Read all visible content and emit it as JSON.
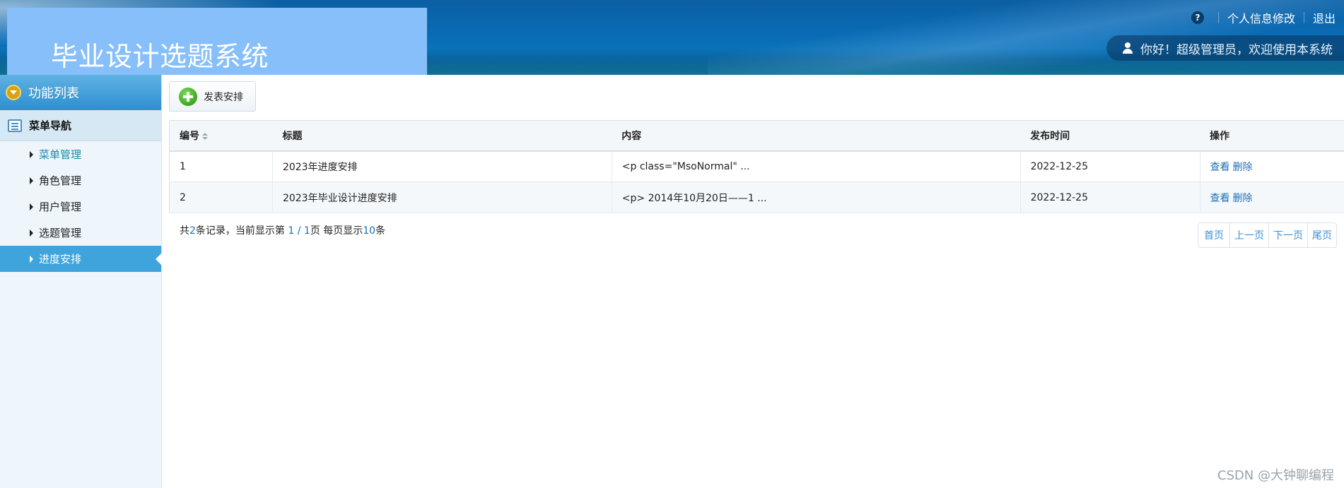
{
  "header": {
    "title": "毕业设计选题系统",
    "help_label": "?",
    "profile_link": "个人信息修改",
    "logout_link": "退出",
    "welcome": "你好！超级管理员，欢迎使用本系统"
  },
  "sidebar": {
    "function_list": "功能列表",
    "menu_nav": "菜单导航",
    "items": [
      {
        "label": "菜单管理"
      },
      {
        "label": "角色管理"
      },
      {
        "label": "用户管理"
      },
      {
        "label": "选题管理"
      },
      {
        "label": "进度安排"
      }
    ],
    "active_index": 4
  },
  "toolbar": {
    "add_label": "发表安排"
  },
  "table": {
    "columns": [
      "编号",
      "标题",
      "内容",
      "发布时间",
      "操作"
    ],
    "rows": [
      {
        "id": "1",
        "title": "2023年进度安排",
        "content": "<p class=\"MsoNormal\" ...",
        "date": "2022-12-25",
        "view": "查看",
        "delete": "删除"
      },
      {
        "id": "2",
        "title": "2023年毕业设计进度安排",
        "content": "<p> 2014年10月20日——1 ...",
        "date": "2022-12-25",
        "view": "查看",
        "delete": "删除"
      }
    ]
  },
  "pagination": {
    "prefix": "共",
    "total": "2",
    "mid1": "条记录，当前显示第",
    "current": "1 / 1",
    "mid2": "页 每页显示",
    "per_page": "10",
    "suffix": "条",
    "first": "首页",
    "prev": "上一页",
    "next": "下一页",
    "last": "尾页"
  },
  "watermark": "CSDN @大钟聊编程",
  "colors": {
    "header_blue": "#0a6bb4",
    "title_box": "#86bff9",
    "sidebar_active": "#3fa3dc",
    "link_blue": "#1f6fb5",
    "pager_blue": "#3a8fd1"
  }
}
